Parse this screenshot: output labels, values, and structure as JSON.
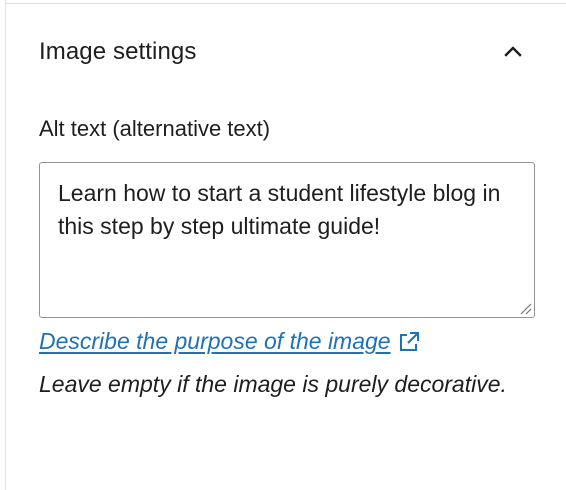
{
  "panel": {
    "title": "Image settings",
    "toggle_icon": "chevron-up-icon"
  },
  "alt_text": {
    "label": "Alt text (alternative text)",
    "value": "Learn how to start a student lifestyle blog in this step by step ultimate guide!"
  },
  "help": {
    "link_label": "Describe the purpose of the image",
    "link_icon": "external-link-icon",
    "description": "Leave empty if the image is purely decorative."
  },
  "colors": {
    "link": "#2271b1",
    "text": "#1e1e1e",
    "border": "#949494"
  }
}
